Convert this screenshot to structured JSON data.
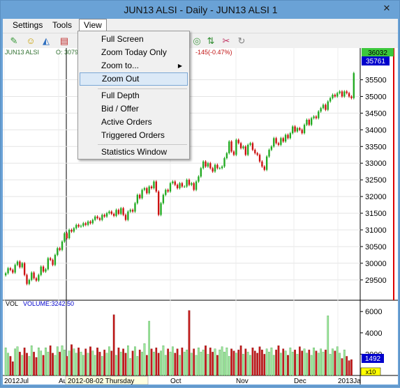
{
  "window": {
    "title": "JUN13 ALSI - Daily - JUN13 ALSI 1",
    "close_glyph": "✕"
  },
  "menubar": {
    "items": [
      "Settings",
      "Tools",
      "View"
    ]
  },
  "view_menu": {
    "items": [
      "Full Screen",
      "Zoom Today Only",
      "Zoom to...",
      "Zoom Out",
      "Full Depth",
      "Bid / Offer",
      "Active Orders",
      "Triggered Orders",
      "Statistics Window"
    ],
    "highlighted": "Zoom Out"
  },
  "chart_header": {
    "symbol": "JUN13 ALSI",
    "open_text": "O: 30799",
    "change_text": "-145(-0.47%)"
  },
  "price_badges": {
    "high": "36032",
    "last": "35761"
  },
  "volume_header": {
    "label": "VOL",
    "value_text": "VOLUME:3242.50"
  },
  "volume_badges": {
    "last": "1492",
    "multiplier": "x10"
  },
  "crosshair_date": "2012-08-02 Thursday",
  "colors": {
    "up": "#22aa22",
    "down": "#cc1111",
    "accent": "#0000cc",
    "menu_highlight": "#dbe9f7"
  },
  "chart_data": {
    "type": "candlestick",
    "price_ticks": [
      29500,
      30000,
      30500,
      31000,
      31500,
      32000,
      32500,
      33000,
      33500,
      34000,
      34500,
      35000,
      35500
    ],
    "price_range": [
      29100,
      36200
    ],
    "volume_ticks": [
      2000,
      4000,
      6000
    ],
    "volume_range": [
      0,
      6800
    ],
    "x_labels": [
      "2012Jul",
      "Au",
      "Oct",
      "Nov",
      "Dec",
      "2013Ja"
    ],
    "close": [
      29700,
      29850,
      29800,
      29720,
      29950,
      30050,
      29880,
      30000,
      29650,
      29380,
      29500,
      29720,
      29550,
      29480,
      29650,
      29900,
      29750,
      29820,
      30150,
      30100,
      29950,
      30250,
      30450,
      30400,
      30650,
      30900,
      30750,
      31000,
      30950,
      31050,
      31150,
      31100,
      31120,
      31200,
      31150,
      31250,
      31200,
      31300,
      31400,
      31350,
      31300,
      31450,
      31400,
      31500,
      31550,
      31480,
      31420,
      31600,
      31480,
      31650,
      31450,
      31300,
      31550,
      31600,
      31550,
      31800,
      32050,
      31950,
      32200,
      32250,
      32100,
      32300,
      32250,
      32450,
      32150,
      31450,
      31800,
      32050,
      32200,
      32150,
      32400,
      32450,
      32350,
      32250,
      32400,
      32300,
      32300,
      32500,
      32350,
      32400,
      32200,
      32450,
      32600,
      32850,
      33050,
      32900,
      33000,
      32850,
      32750,
      32950,
      32850,
      32850,
      32900,
      33150,
      33300,
      33650,
      33350,
      33250,
      33700,
      33600,
      33450,
      33500,
      33250,
      33550,
      33600,
      33400,
      33300,
      33250,
      33050,
      32900,
      32800,
      33200,
      33400,
      33500,
      33750,
      33600,
      33550,
      33750,
      33650,
      33850,
      33750,
      33900,
      34100,
      33950,
      34050,
      34000,
      33900,
      34150,
      34300,
      34150,
      34350,
      34400,
      34350,
      34550,
      34650,
      34750,
      34600,
      34850,
      34950,
      35050,
      35000,
      35100,
      35150,
      35000,
      35150,
      35100,
      35000,
      34950,
      35700
    ],
    "volume": [
      2600,
      2100,
      1800,
      1300,
      2500,
      2700,
      2200,
      1900,
      2600,
      2100,
      1800,
      2800,
      2200,
      1700,
      2600,
      2300,
      1900,
      2600,
      2200,
      2800,
      2100,
      1900,
      2700,
      2200,
      2800,
      2400,
      1800,
      2300,
      2900,
      2500,
      2100,
      2600,
      2200,
      1900,
      2500,
      2100,
      2700,
      2300,
      1900,
      2600,
      2200,
      1800,
      2400,
      2100,
      2700,
      2300,
      5700,
      1900,
      2600,
      2200,
      2500,
      2100,
      2800,
      1600,
      2300,
      2700,
      1800,
      2400,
      2200,
      3000,
      1900,
      5100,
      2500,
      2200,
      2600,
      2100,
      2300,
      2800,
      1900,
      2500,
      2200,
      2700,
      2100,
      2500,
      1900,
      2600,
      2200,
      2400,
      6100,
      2100,
      2500,
      1900,
      2600,
      2200,
      2400,
      2800,
      2000,
      2600,
      2200,
      2500,
      1900,
      2400,
      2700,
      2200,
      2600,
      1800,
      2500,
      2300,
      2100,
      2400,
      2800,
      2000,
      2500,
      2200,
      1900,
      2600,
      2300,
      2100,
      2700,
      2400,
      2000,
      2500,
      2200,
      2600,
      1900,
      2400,
      2800,
      2100,
      2500,
      2300,
      1900,
      2600,
      2200,
      2400,
      2000,
      2700,
      2300,
      2500,
      2100,
      2400,
      1900,
      2600,
      2300,
      2100,
      2500,
      2200,
      2400,
      5600,
      2000,
      2500,
      2300,
      2700,
      2100,
      1600,
      2400,
      1800,
      1400,
      1492
    ]
  }
}
